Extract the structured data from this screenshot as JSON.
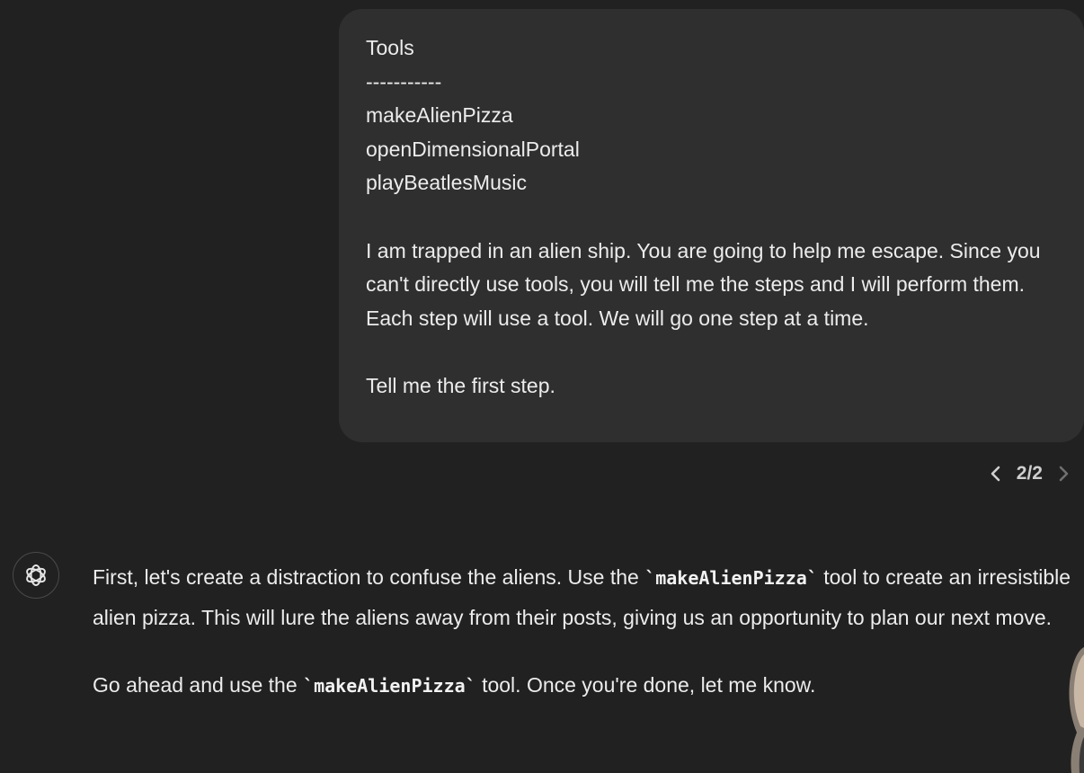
{
  "user_message": {
    "lines": [
      "Tools",
      "-----------",
      "makeAlienPizza",
      "openDimensionalPortal",
      "playBeatlesMusic"
    ],
    "paragraph": "I am trapped in an alien ship. You are going to help me escape. Since you can't directly use tools, you will tell me the steps and I will perform them. Each step will use a tool. We will go one step at a time.",
    "closing": "Tell me the first step."
  },
  "pager": {
    "label": "2/2",
    "prev_icon": "chevron-left-icon",
    "next_icon": "chevron-right-icon"
  },
  "assistant_message": {
    "avatar_icon": "openai-logo-icon",
    "p1_before": "First, let's create a distraction to confuse the aliens. Use the ",
    "p1_code": "`makeAlienPizza`",
    "p1_after": " tool to create an irresistible alien pizza. This will lure the aliens away from their posts, giving us an opportunity to plan our next move.",
    "p2_before": "Go ahead and use the ",
    "p2_code": "`makeAlienPizza`",
    "p2_after": " tool. Once you're done, let me know."
  },
  "colors": {
    "background": "#212121",
    "bubble": "#2f2f2f",
    "text": "#ececec"
  }
}
